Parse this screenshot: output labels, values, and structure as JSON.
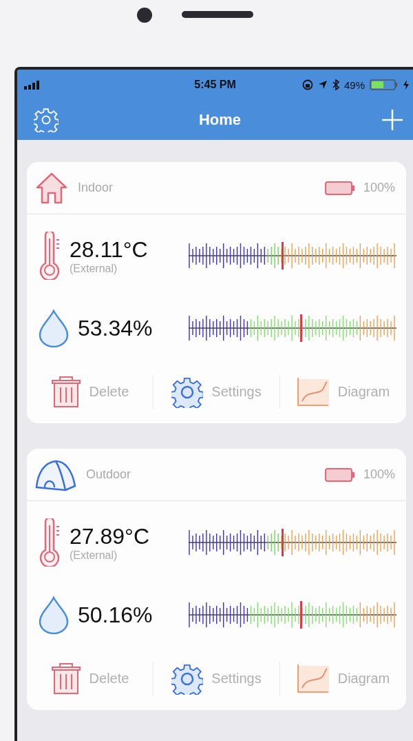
{
  "status_bar": {
    "time": "5:45 PM",
    "battery": "49%"
  },
  "nav_bar": {
    "title": "Home"
  },
  "devices": [
    {
      "kind": "house",
      "name": "Indoor",
      "battery": "100%",
      "readings": [
        {
          "kind": "temperature",
          "value": "28.11°C",
          "note": "(External)"
        },
        {
          "kind": "humidity",
          "value": "53.34%"
        }
      ],
      "actions": [
        "Delete",
        "Settings",
        "Diagram"
      ]
    },
    {
      "kind": "tent",
      "name": "Outdoor",
      "battery": "100%",
      "readings": [
        {
          "kind": "temperature",
          "value": "27.89°C",
          "note": "(External)"
        },
        {
          "kind": "humidity",
          "value": "50.16%"
        }
      ],
      "actions": [
        "Delete",
        "Settings",
        "Diagram"
      ]
    }
  ]
}
